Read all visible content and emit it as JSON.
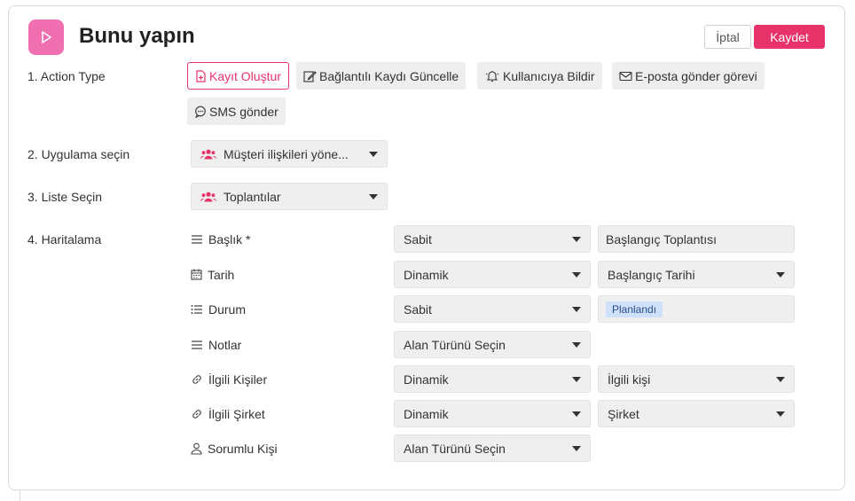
{
  "header": {
    "title": "Bunu yapın",
    "cancel_label": "İptal",
    "save_label": "Kaydet"
  },
  "colors": {
    "accent": "#e8336a",
    "logo_bg": "#f06fb1",
    "tag_bg": "#cfe0fb"
  },
  "steps": {
    "action_type": {
      "label": "1. Action Type",
      "options": [
        {
          "label": "Kayıt Oluştur",
          "icon": "file-plus-icon",
          "selected": true
        },
        {
          "label": "Bağlantılı Kaydı Güncelle",
          "icon": "edit-icon",
          "selected": false
        },
        {
          "label": "Kullanıcıya Bildir",
          "icon": "bell-icon",
          "selected": false
        },
        {
          "label": "E-posta gönder görevi",
          "icon": "mail-icon",
          "selected": false
        },
        {
          "label": "SMS gönder",
          "icon": "sms-icon",
          "selected": false
        }
      ]
    },
    "app": {
      "label": "2. Uygulama seçin",
      "value": "Müşteri ilişkileri yöne..."
    },
    "list": {
      "label": "3. Liste Seçin",
      "value": "Toplantılar"
    },
    "mapping": {
      "label": "4. Haritalama",
      "fields": [
        {
          "name": "Başlık *",
          "icon": "lines-icon",
          "type": "Sabit",
          "value": "Başlangıç Toplantısı",
          "value_kind": "text"
        },
        {
          "name": "Tarih",
          "icon": "calendar-icon",
          "type": "Dinamik",
          "value": "Başlangıç Tarihi",
          "value_kind": "select"
        },
        {
          "name": "Durum",
          "icon": "list-icon",
          "type": "Sabit",
          "value": "Planlandı",
          "value_kind": "tag"
        },
        {
          "name": "Notlar",
          "icon": "lines-icon",
          "type": "Alan Türünü Seçin",
          "value": "",
          "value_kind": "none"
        },
        {
          "name": "İlgili Kişiler",
          "icon": "link-icon",
          "type": "Dinamik",
          "value": "İlgili kişi",
          "value_kind": "select"
        },
        {
          "name": "İlgili Şirket",
          "icon": "link-icon",
          "type": "Dinamik",
          "value": "Şirket",
          "value_kind": "select"
        },
        {
          "name": "Sorumlu Kişi",
          "icon": "user-icon",
          "type": "Alan Türünü Seçin",
          "value": "",
          "value_kind": "none"
        }
      ]
    }
  }
}
